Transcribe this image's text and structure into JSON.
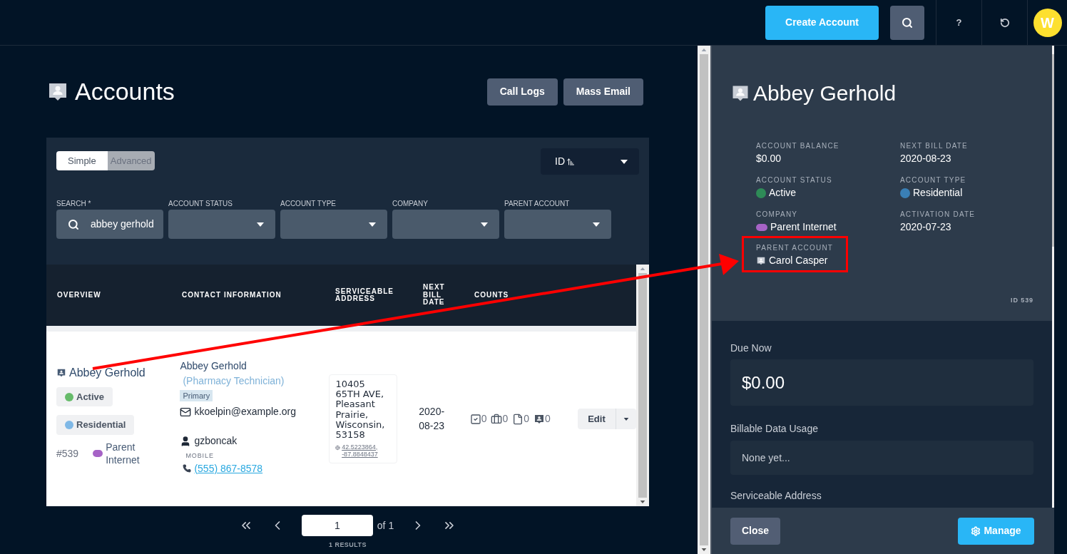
{
  "topbar": {
    "create_button": "Create Account",
    "help": "?",
    "avatar": "W"
  },
  "page": {
    "title": "Accounts",
    "actions": [
      "Call Logs",
      "Mass Email"
    ]
  },
  "search_modes": [
    {
      "label": "Simple",
      "selected": true
    },
    {
      "label": "Advanced",
      "selected": false
    }
  ],
  "sort": {
    "label": "ID"
  },
  "filters": [
    {
      "kind": "search",
      "label": "SEARCH *",
      "value": "abbey gerhold"
    },
    {
      "kind": "select",
      "label": "ACCOUNT STATUS"
    },
    {
      "kind": "select",
      "label": "ACCOUNT TYPE"
    },
    {
      "kind": "select",
      "label": "COMPANY"
    },
    {
      "kind": "select",
      "label": "PARENT ACCOUNT"
    }
  ],
  "table": {
    "columns": [
      "OVERVIEW",
      "CONTACT INFORMATION",
      "SERVICEABLE ADDRESS",
      "NEXT BILL DATE",
      "COUNTS"
    ],
    "rows": [
      {
        "name": "Abbey Gerhold",
        "status": {
          "label": "Active",
          "color": "#66bb6a"
        },
        "type": {
          "label": "Residential",
          "color": "#7fb8e6"
        },
        "id": "#539",
        "company": {
          "name": "Parent Internet",
          "color": "#a663c6"
        },
        "contact": {
          "name": "Abbey Gerhold",
          "title": "(Pharmacy Technician)",
          "badge": "Primary",
          "email": "kkoelpin@example.org",
          "username": "gzboncak",
          "phone_label": "MOBILE",
          "phone": "(555) 867-8578"
        },
        "address": "10405 65TH AVE, Pleasant Prairie, Wisconsin, 53158",
        "coordinates": "42.5223864, -87.8848437",
        "next_bill": "2020-08-23",
        "counts": [
          {
            "kind": "tasks",
            "value": "0"
          },
          {
            "kind": "jobs",
            "value": "0"
          },
          {
            "kind": "files",
            "value": "0"
          },
          {
            "kind": "accounts",
            "value": "0"
          }
        ],
        "action": "Edit"
      }
    ]
  },
  "pagination": {
    "page": "1",
    "of": "of 1",
    "results": "1 RESULTS"
  },
  "detail": {
    "name": "Abbey Gerhold",
    "fields": [
      {
        "kind": "text",
        "label": "ACCOUNT BALANCE",
        "value": "$0.00"
      },
      {
        "kind": "text",
        "label": "NEXT BILL DATE",
        "value": "2020-08-23"
      },
      {
        "kind": "dot",
        "label": "ACCOUNT STATUS",
        "value": "Active",
        "color": "#2e8b57"
      },
      {
        "kind": "dot",
        "label": "ACCOUNT TYPE",
        "value": "Residential",
        "color": "#3a7fb5"
      },
      {
        "kind": "pill",
        "label": "COMPANY",
        "value": "Parent Internet",
        "color": "#a663c6"
      },
      {
        "kind": "text",
        "label": "ACTIVATION DATE",
        "value": "2020-07-23"
      },
      {
        "kind": "account",
        "label": "PARENT ACCOUNT",
        "value": "Carol Casper",
        "highlighted": true
      }
    ],
    "id": "ID 539",
    "due_now": {
      "label": "Due Now",
      "value": "$0.00"
    },
    "data_usage": {
      "label": "Billable Data Usage",
      "value": "None yet..."
    },
    "address_label": "Serviceable Address",
    "buttons": {
      "close": "Close",
      "manage": "Manage"
    }
  }
}
